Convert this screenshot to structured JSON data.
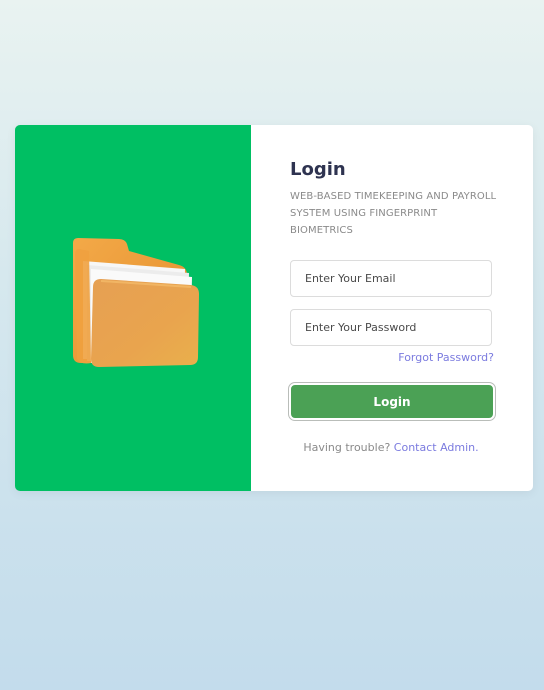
{
  "login": {
    "title": "Login",
    "subtitle": "WEB-BASED TIMEKEEPING AND PAYROLL SYSTEM USING FINGERPRINT BIOMETRICS",
    "email_placeholder": "Enter Your Email",
    "password_placeholder": "Enter Your Password",
    "forgot_password": "Forgot Password?",
    "login_button": "Login",
    "trouble_text": "Having trouble?",
    "contact_link": "Contact Admin."
  },
  "illustration": {
    "icon": "folder-icon"
  },
  "colors": {
    "left_panel": "#00bf63",
    "button": "#4ba155",
    "link": "#7b7bdf",
    "title": "#2e3350"
  }
}
